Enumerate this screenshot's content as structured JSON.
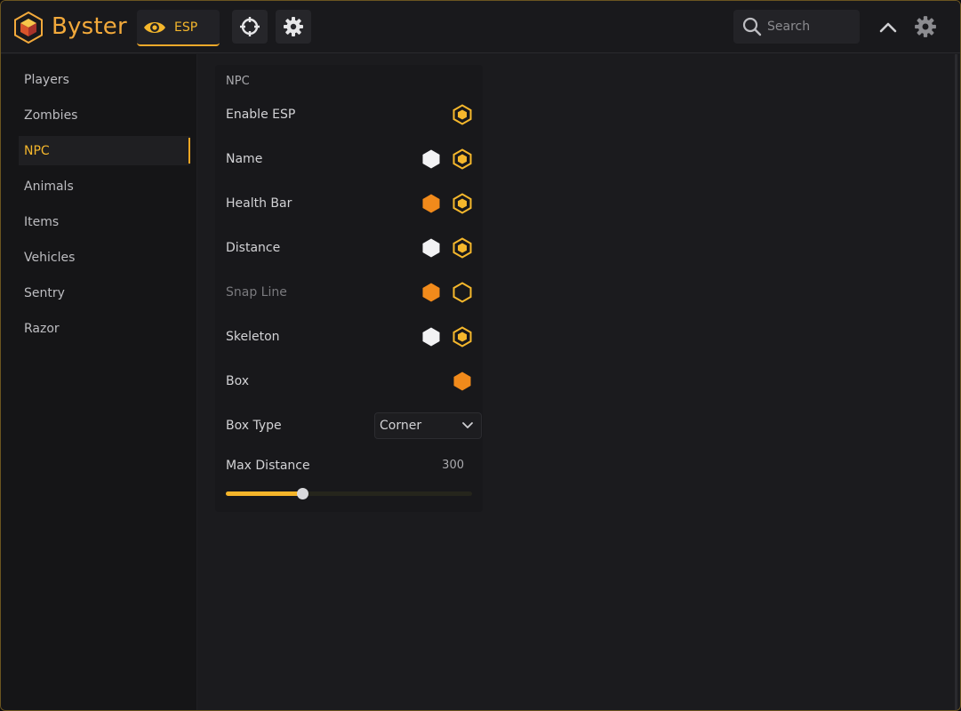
{
  "app": {
    "title": "Byster",
    "accent": "#f5b72c",
    "orange": "#f18a1b"
  },
  "topbar": {
    "tabs": [
      {
        "label": "ESP",
        "icon": "eye-icon",
        "active": true
      },
      {
        "label": "",
        "icon": "crosshair-icon",
        "active": false
      },
      {
        "label": "",
        "icon": "gear-icon",
        "active": false
      }
    ],
    "search": {
      "placeholder": "Search",
      "value": ""
    }
  },
  "sidebar": {
    "items": [
      {
        "label": "Players",
        "active": false
      },
      {
        "label": "Zombies",
        "active": false
      },
      {
        "label": "NPC",
        "active": true
      },
      {
        "label": "Animals",
        "active": false
      },
      {
        "label": "Items",
        "active": false
      },
      {
        "label": "Vehicles",
        "active": false
      },
      {
        "label": "Sentry",
        "active": false
      },
      {
        "label": "Razor",
        "active": false
      }
    ]
  },
  "panel": {
    "title": "NPC",
    "rows": [
      {
        "label": "Enable ESP",
        "color": null,
        "toggle": "on",
        "dim": false
      },
      {
        "label": "Name",
        "color": "white",
        "toggle": "on",
        "dim": false
      },
      {
        "label": "Health Bar",
        "color": "orange",
        "toggle": "on",
        "dim": false
      },
      {
        "label": "Distance",
        "color": "white",
        "toggle": "on",
        "dim": false
      },
      {
        "label": "Snap Line",
        "color": "orange",
        "toggle": "off",
        "dim": true
      },
      {
        "label": "Skeleton",
        "color": "white",
        "toggle": "on",
        "dim": false
      },
      {
        "label": "Box",
        "color": "orange",
        "toggle": null,
        "dim": false
      }
    ],
    "box_type": {
      "label": "Box Type",
      "value": "Corner"
    },
    "max_distance": {
      "label": "Max Distance",
      "value": "300",
      "fraction": 0.31
    }
  }
}
